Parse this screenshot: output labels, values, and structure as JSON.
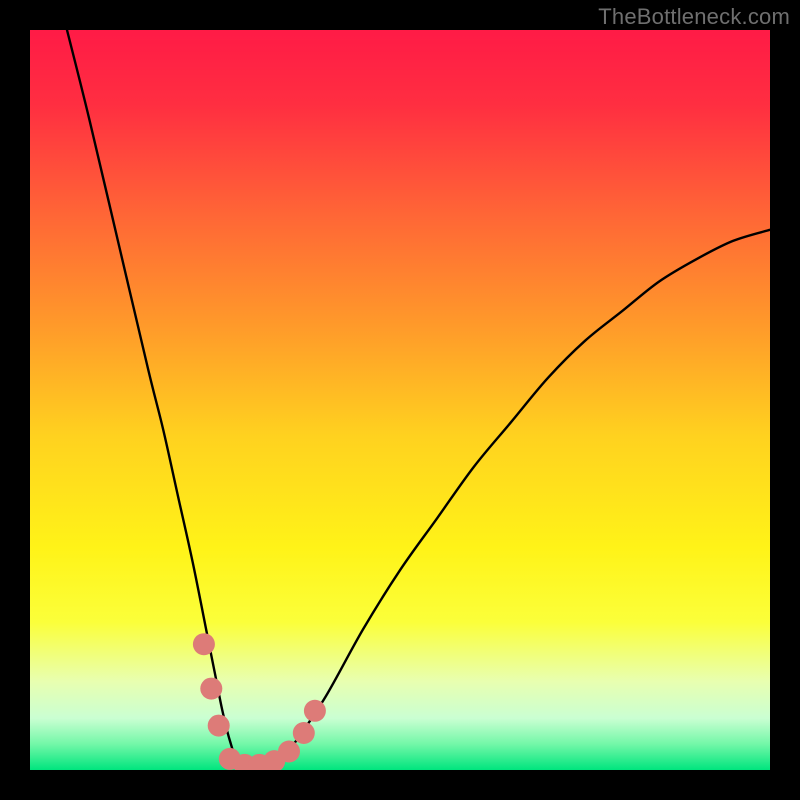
{
  "watermark": "TheBottleneck.com",
  "chart_data": {
    "type": "line",
    "title": "",
    "xlabel": "",
    "ylabel": "",
    "xlim": [
      0,
      100
    ],
    "ylim": [
      0,
      100
    ],
    "series": [
      {
        "name": "curve",
        "x": [
          5,
          8,
          12,
          16,
          18,
          20,
          22,
          24,
          25,
          26,
          27,
          28,
          30,
          32,
          34,
          36,
          40,
          45,
          50,
          55,
          60,
          65,
          70,
          75,
          80,
          85,
          90,
          95,
          100
        ],
        "y": [
          100,
          88,
          71,
          54,
          46,
          37,
          28,
          18,
          13,
          8,
          4,
          1.5,
          0.5,
          0.5,
          1.5,
          4,
          10,
          19,
          27,
          34,
          41,
          47,
          53,
          58,
          62,
          66,
          69,
          71.5,
          73
        ]
      }
    ],
    "markers": {
      "name": "highlight-dots",
      "color": "#dd7b78",
      "points": [
        {
          "x": 23.5,
          "y": 17
        },
        {
          "x": 24.5,
          "y": 11
        },
        {
          "x": 25.5,
          "y": 6
        },
        {
          "x": 27,
          "y": 1.5
        },
        {
          "x": 29,
          "y": 0.7
        },
        {
          "x": 31,
          "y": 0.7
        },
        {
          "x": 33,
          "y": 1.2
        },
        {
          "x": 35,
          "y": 2.5
        },
        {
          "x": 37,
          "y": 5
        },
        {
          "x": 38.5,
          "y": 8
        }
      ]
    },
    "gradient_stops": [
      {
        "offset": 0.0,
        "color": "#ff1b46"
      },
      {
        "offset": 0.1,
        "color": "#ff2e41"
      },
      {
        "offset": 0.25,
        "color": "#ff6636"
      },
      {
        "offset": 0.4,
        "color": "#ff9a2a"
      },
      {
        "offset": 0.55,
        "color": "#ffd21f"
      },
      {
        "offset": 0.7,
        "color": "#fff318"
      },
      {
        "offset": 0.8,
        "color": "#fbff3a"
      },
      {
        "offset": 0.88,
        "color": "#e8ffb0"
      },
      {
        "offset": 0.93,
        "color": "#caffd2"
      },
      {
        "offset": 0.965,
        "color": "#73f7a8"
      },
      {
        "offset": 1.0,
        "color": "#00e57e"
      }
    ]
  }
}
